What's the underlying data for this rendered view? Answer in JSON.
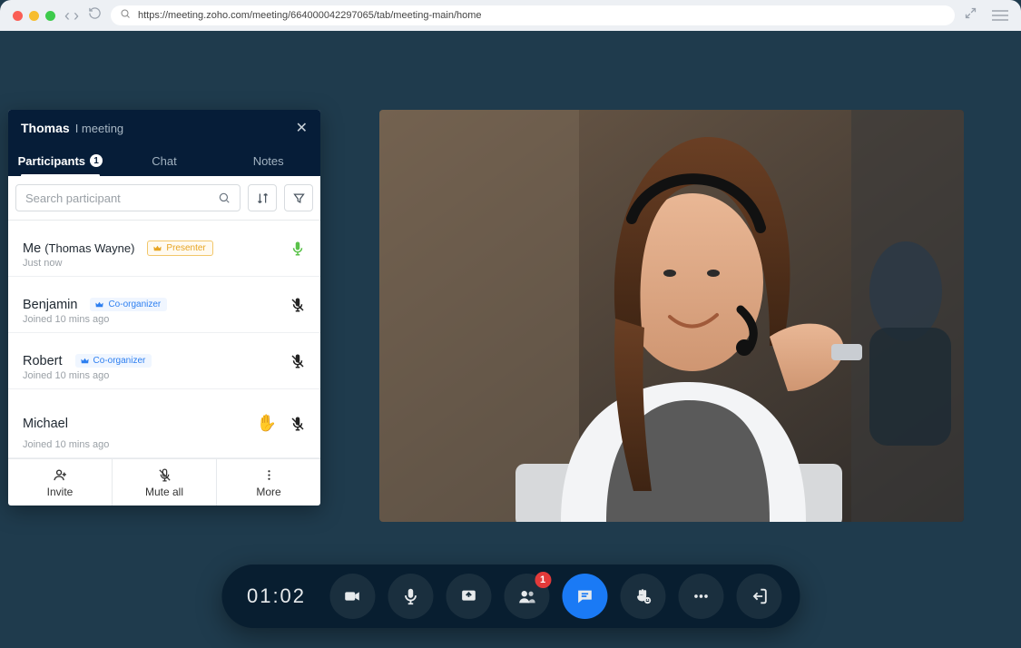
{
  "browser": {
    "url": "https://meeting.zoho.com/meeting/664000042297065/tab/meeting-main/home"
  },
  "panel": {
    "title_prefix": "Thomas",
    "title_suffix": "I meeting",
    "tabs": {
      "participants": "Participants",
      "participants_count": "1",
      "chat": "Chat",
      "notes": "Notes"
    },
    "search_placeholder": "Search participant",
    "participants": [
      {
        "name": "Me",
        "sub": "(Thomas Wayne)",
        "badge": "Presenter",
        "badge_type": "presenter",
        "meta": "Just now",
        "mic": "on",
        "hand": false
      },
      {
        "name": "Benjamin",
        "sub": "",
        "badge": "Co-organizer",
        "badge_type": "co",
        "meta": "Joined 10 mins ago",
        "mic": "muted",
        "hand": false
      },
      {
        "name": "Robert",
        "sub": "",
        "badge": "Co-organizer",
        "badge_type": "co",
        "meta": "Joined 10 mins ago",
        "mic": "muted",
        "hand": false
      },
      {
        "name": "Michael",
        "sub": "",
        "badge": "",
        "badge_type": "",
        "meta": "Joined 10 mins ago",
        "mic": "muted",
        "hand": true
      }
    ],
    "footer": {
      "invite": "Invite",
      "mute_all": "Mute all",
      "more": "More"
    }
  },
  "toolbar": {
    "timer": "01:02",
    "chat_badge": "1"
  }
}
